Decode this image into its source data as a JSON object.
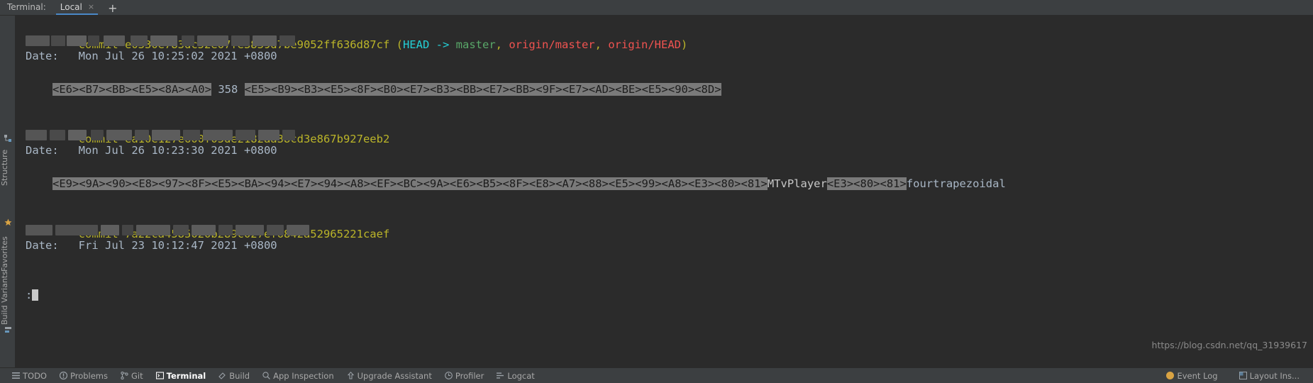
{
  "terminal_tabs": {
    "title": "Terminal:",
    "tabs": [
      {
        "label": "Local",
        "close": "×",
        "active": true
      }
    ],
    "add_label": "+"
  },
  "left_tool_strip": {
    "items": [
      {
        "label": "Structure",
        "icon": "structure-icon"
      },
      {
        "label": "Favorites",
        "icon": "star-icon"
      },
      {
        "label": "Build Variants",
        "icon": "build-variants-icon"
      }
    ]
  },
  "colors": {
    "background": "#2b2b2b",
    "chrome": "#3c3f41",
    "commit_yellow": "#bbb529",
    "text_grey": "#a9b7c6",
    "head_cyan": "#24d0d6",
    "branch_green": "#59a869",
    "remote_red": "#f05350",
    "selection": "#7a7a7a",
    "accent_tab": "#4a88c7"
  },
  "terminal": {
    "commits": [
      {
        "commit_label": "commit",
        "hash": "e0330e783dc52e67fe3839d7be9052ff636d87cf",
        "decorations": {
          "open": "(",
          "head": "HEAD",
          "arrow": "->",
          "local_branch": "master",
          "sep1": ", ",
          "remote_branch": "origin/master",
          "sep2": ", ",
          "remote_head": "origin/HEAD",
          "close": ")"
        },
        "author_redacted": true,
        "date_label": "Date:",
        "date_value": "Mon Jul 26 10:25:02 2021 +0800",
        "message_segments": [
          {
            "text": "<E6><B7><BB><E5><8A><A0>",
            "highlight": true
          },
          {
            "text": " ",
            "highlight": false
          },
          {
            "text": "358",
            "highlight": false
          },
          {
            "text": " ",
            "highlight": false
          },
          {
            "text": "<E5><B9><B3><E5><8F><B0><E7><B3><BB><E7><BB><9F><E7><AD><BE><E5><90><8D>",
            "highlight": true
          }
        ]
      },
      {
        "commit_label": "commit",
        "hash": "ea10e127e600f05de2182aa38cd3e867b927eeb2",
        "decorations": null,
        "author_redacted": true,
        "date_label": "Date:",
        "date_value": "Mon Jul 26 10:23:30 2021 +0800",
        "message_segments": [
          {
            "text": "<E9><9A><90><E8><97><8F><E5><BA><94><E7><94><A8><EF><BC><9A><E6><B5><8F><E8><A7><88><E5><99><A8><E3><80><81>",
            "highlight": true
          },
          {
            "text": "MTvPlayer",
            "highlight": false
          },
          {
            "text": "<E3><80><81>",
            "highlight": true
          },
          {
            "text": "fourtrapezoidal",
            "highlight": false
          }
        ]
      },
      {
        "commit_label": "commit",
        "hash": "7a22ca4585020b289c027ef6842a52965221caef",
        "decorations": null,
        "author_redacted": true,
        "date_label": "Date:",
        "date_value": "Fri Jul 23 10:12:47 2021 +0800",
        "message_segments": []
      }
    ],
    "prompt": ":",
    "watermark": "https://blog.csdn.net/qq_31939617"
  },
  "status_bar": {
    "items": [
      {
        "label": "TODO",
        "icon": "todo-icon",
        "active": false
      },
      {
        "label": "Problems",
        "icon": "problems-icon",
        "active": false
      },
      {
        "label": "Git",
        "icon": "git-branch-icon",
        "active": false
      },
      {
        "label": "Terminal",
        "icon": "terminal-icon",
        "active": true
      },
      {
        "label": "Build",
        "icon": "build-hammer-icon",
        "active": false
      },
      {
        "label": "App Inspection",
        "icon": "app-inspection-icon",
        "active": false
      },
      {
        "label": "Upgrade Assistant",
        "icon": "upgrade-assistant-icon",
        "active": false
      },
      {
        "label": "Profiler",
        "icon": "profiler-icon",
        "active": false
      },
      {
        "label": "Logcat",
        "icon": "logcat-icon",
        "active": false
      }
    ],
    "right_items": [
      {
        "label": "Event Log",
        "icon": "event-log-icon"
      },
      {
        "label": "Layout Ins...",
        "icon": "layout-inspector-icon"
      }
    ]
  }
}
